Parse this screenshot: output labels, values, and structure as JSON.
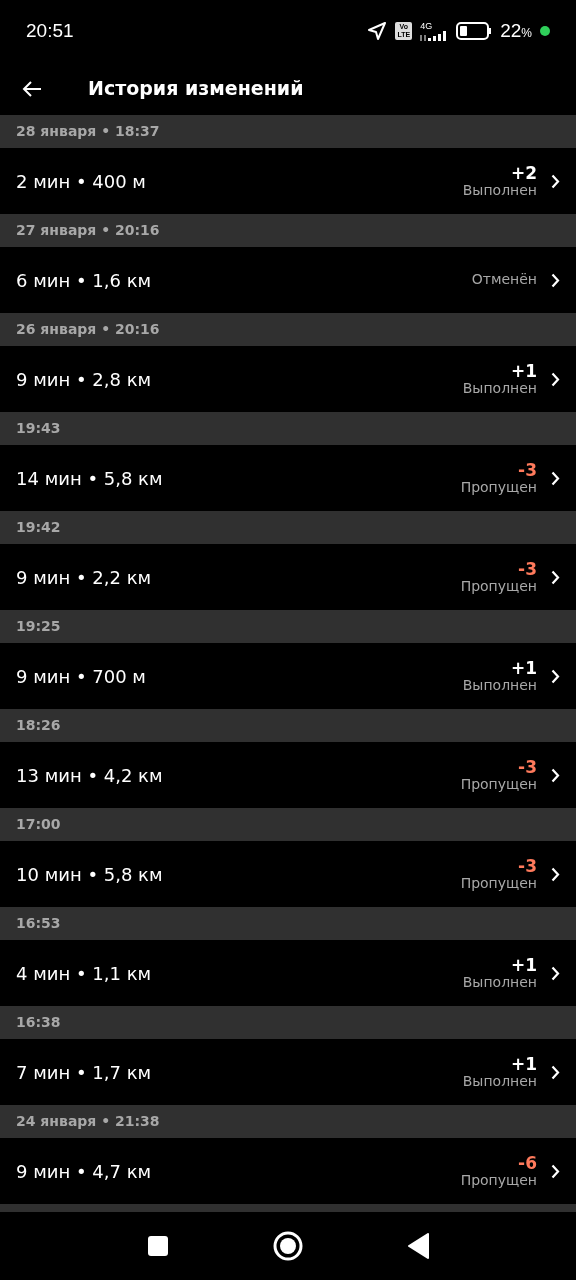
{
  "status_bar": {
    "time": "20:51",
    "volte": [
      "Vo",
      "LTE"
    ],
    "network": "4G",
    "battery": "22",
    "battery_unit": "%"
  },
  "header": {
    "title": "История изменений"
  },
  "groups": [
    {
      "heading": "28 января • 18:37",
      "row": {
        "summary": "2 мин • 400 м",
        "points": "+2",
        "color": "#ffffff",
        "status": "Выполнен"
      }
    },
    {
      "heading": "27 января • 20:16",
      "row": {
        "summary": "6 мин • 1,6 км",
        "status": "Отменён"
      }
    },
    {
      "heading": "26 января • 20:16",
      "row": {
        "summary": "9 мин • 2,8 км",
        "points": "+1",
        "color": "#ffffff",
        "status": "Выполнен"
      }
    },
    {
      "heading": "19:43",
      "row": {
        "summary": "14 мин • 5,8 км",
        "points": "-3",
        "color": "#ff7a5c",
        "status": "Пропущен"
      }
    },
    {
      "heading": "19:42",
      "row": {
        "summary": "9 мин • 2,2 км",
        "points": "-3",
        "color": "#ff7a5c",
        "status": "Пропущен"
      }
    },
    {
      "heading": "19:25",
      "row": {
        "summary": "9 мин • 700 м",
        "points": "+1",
        "color": "#ffffff",
        "status": "Выполнен"
      }
    },
    {
      "heading": "18:26",
      "row": {
        "summary": "13 мин • 4,2 км",
        "points": "-3",
        "color": "#ff7a5c",
        "status": "Пропущен"
      }
    },
    {
      "heading": "17:00",
      "row": {
        "summary": "10 мин • 5,8 км",
        "points": "-3",
        "color": "#ff7a5c",
        "status": "Пропущен"
      }
    },
    {
      "heading": "16:53",
      "row": {
        "summary": "4 мин • 1,1 км",
        "points": "+1",
        "color": "#ffffff",
        "status": "Выполнен"
      }
    },
    {
      "heading": "16:38",
      "row": {
        "summary": "7 мин • 1,7 км",
        "points": "+1",
        "color": "#ffffff",
        "status": "Выполнен"
      }
    },
    {
      "heading": "24 января • 21:38",
      "row": {
        "summary": "9 мин • 4,7 км",
        "points": "-6",
        "color": "#ff7a5c",
        "status": "Пропущен"
      }
    }
  ]
}
